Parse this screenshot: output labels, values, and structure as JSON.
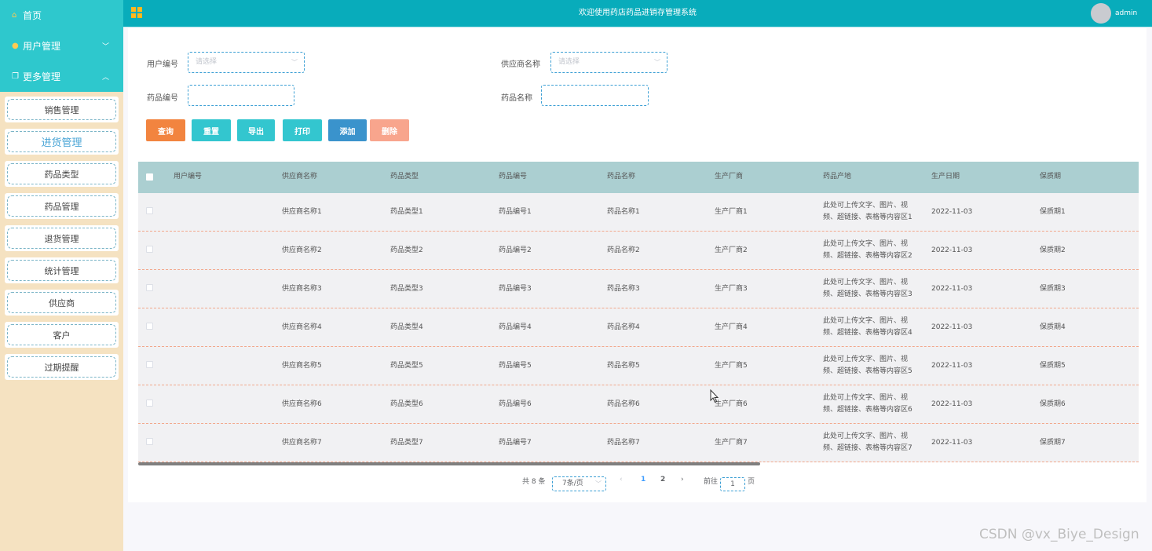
{
  "header": {
    "title": "欢迎使用药店药品进销存管理系统",
    "user": "admin"
  },
  "sidebar": {
    "top": [
      {
        "label": "首页",
        "icon": "home-icon",
        "chev": ""
      },
      {
        "label": "用户管理",
        "icon": "user-icon",
        "chev": "﹀"
      },
      {
        "label": "更多管理",
        "icon": "copy-icon",
        "chev": "︿"
      }
    ],
    "sub": [
      "销售管理",
      "进货管理",
      "药品类型",
      "药品管理",
      "退货管理",
      "统计管理",
      "供应商",
      "客户",
      "过期提醒"
    ]
  },
  "form": {
    "user_no_label": "用户编号",
    "user_no_placeholder": "请选择",
    "supplier_label": "供应商名称",
    "supplier_placeholder": "请选择",
    "drug_no_label": "药品编号",
    "drug_name_label": "药品名称"
  },
  "buttons": {
    "query": "查询",
    "reset": "重置",
    "export": "导出",
    "print": "打印",
    "add": "添加",
    "delete": "删除"
  },
  "colors": {
    "query": "#f2843f",
    "teal": "#33c6cf",
    "add": "#3a93cc",
    "delete": "#f8a58d"
  },
  "table": {
    "headers": [
      "用户编号",
      "供应商名称",
      "药品类型",
      "药品编号",
      "药品名称",
      "生产厂商",
      "药品产地",
      "生产日期",
      "保质期"
    ],
    "rows": [
      [
        "",
        "供应商名称1",
        "药品类型1",
        "药品编号1",
        "药品名称1",
        "生产厂商1",
        "此处可上传文字、图片、视",
        "频、超链接、表格等内容区1",
        "2022-11-03",
        "保质期1"
      ],
      [
        "",
        "供应商名称2",
        "药品类型2",
        "药品编号2",
        "药品名称2",
        "生产厂商2",
        "此处可上传文字、图片、视",
        "频、超链接、表格等内容区2",
        "2022-11-03",
        "保质期2"
      ],
      [
        "",
        "供应商名称3",
        "药品类型3",
        "药品编号3",
        "药品名称3",
        "生产厂商3",
        "此处可上传文字、图片、视",
        "频、超链接、表格等内容区3",
        "2022-11-03",
        "保质期3"
      ],
      [
        "",
        "供应商名称4",
        "药品类型4",
        "药品编号4",
        "药品名称4",
        "生产厂商4",
        "此处可上传文字、图片、视",
        "频、超链接、表格等内容区4",
        "2022-11-03",
        "保质期4"
      ],
      [
        "",
        "供应商名称5",
        "药品类型5",
        "药品编号5",
        "药品名称5",
        "生产厂商5",
        "此处可上传文字、图片、视",
        "频、超链接、表格等内容区5",
        "2022-11-03",
        "保质期5"
      ],
      [
        "",
        "供应商名称6",
        "药品类型6",
        "药品编号6",
        "药品名称6",
        "生产厂商6",
        "此处可上传文字、图片、视",
        "频、超链接、表格等内容区6",
        "2022-11-03",
        "保质期6"
      ],
      [
        "",
        "供应商名称7",
        "药品类型7",
        "药品编号7",
        "药品名称7",
        "生产厂商7",
        "此处可上传文字、图片、视",
        "频、超链接、表格等内容区7",
        "2022-11-03",
        "保质期7"
      ]
    ]
  },
  "pager": {
    "total": "共 8 条",
    "size": "7条/页",
    "prev": "‹",
    "page1": "1",
    "page2": "2",
    "next": "›",
    "goto": "前往",
    "page_input": "1",
    "page_unit": "页"
  },
  "watermark": "CSDN @vx_Biye_Design"
}
